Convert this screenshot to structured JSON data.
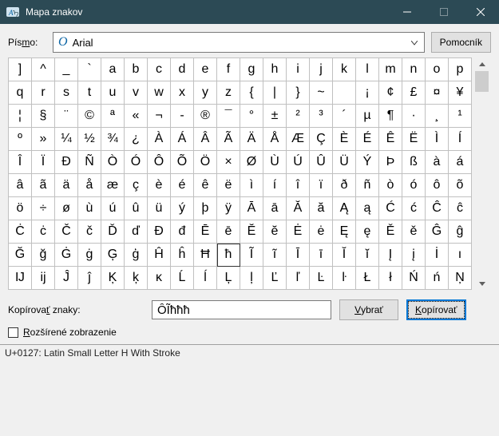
{
  "window": {
    "title": "Mapa znakov"
  },
  "toolbar": {
    "font_label_pre": "Pís",
    "font_label_u": "m",
    "font_label_post": "o:",
    "font_name": "Arial",
    "font_glyph": "O",
    "help_label": "Pomocník"
  },
  "grid": {
    "rows": [
      [
        "]",
        "^",
        "_",
        "`",
        "a",
        "b",
        "c",
        "d",
        "e",
        "f",
        "g",
        "h",
        "i",
        "j",
        "k",
        "l",
        "m",
        "n",
        "o",
        "p"
      ],
      [
        "q",
        "r",
        "s",
        "t",
        "u",
        "v",
        "w",
        "x",
        "y",
        "z",
        "{",
        "|",
        "}",
        "~",
        "",
        "¡",
        "¢",
        "£",
        "¤",
        "¥"
      ],
      [
        "¦",
        "§",
        "¨",
        "©",
        "ª",
        "«",
        "¬",
        "-",
        "®",
        "¯",
        "°",
        "±",
        "²",
        "³",
        "´",
        "µ",
        "¶",
        "·",
        "¸",
        "¹"
      ],
      [
        "º",
        "»",
        "¼",
        "½",
        "¾",
        "¿",
        "À",
        "Á",
        "Â",
        "Ã",
        "Ä",
        "Å",
        "Æ",
        "Ç",
        "È",
        "É",
        "Ê",
        "Ë",
        "Ì",
        "Í"
      ],
      [
        "Î",
        "Ï",
        "Ð",
        "Ñ",
        "Ò",
        "Ó",
        "Ô",
        "Õ",
        "Ö",
        "×",
        "Ø",
        "Ù",
        "Ú",
        "Û",
        "Ü",
        "Ý",
        "Þ",
        "ß",
        "à",
        "á"
      ],
      [
        "â",
        "ã",
        "ä",
        "å",
        "æ",
        "ç",
        "è",
        "é",
        "ê",
        "ë",
        "ì",
        "í",
        "î",
        "ï",
        "ð",
        "ñ",
        "ò",
        "ó",
        "ô",
        "õ"
      ],
      [
        "ö",
        "÷",
        "ø",
        "ù",
        "ú",
        "û",
        "ü",
        "ý",
        "þ",
        "ÿ",
        "Ā",
        "ā",
        "Ă",
        "ă",
        "Ą",
        "ą",
        "Ć",
        "ć",
        "Ĉ",
        "ĉ"
      ],
      [
        "Ċ",
        "ċ",
        "Č",
        "č",
        "Ď",
        "ď",
        "Đ",
        "đ",
        "Ē",
        "ē",
        "Ĕ",
        "ĕ",
        "Ė",
        "ė",
        "Ę",
        "ę",
        "Ě",
        "ě",
        "Ĝ",
        "ĝ"
      ],
      [
        "Ğ",
        "ğ",
        "Ġ",
        "ġ",
        "Ģ",
        "ģ",
        "Ĥ",
        "ĥ",
        "Ħ",
        "ħ",
        "Ĩ",
        "ĩ",
        "Ī",
        "ī",
        "Ĭ",
        "ĭ",
        "Į",
        "į",
        "İ",
        "ı"
      ],
      [
        "Ĳ",
        "ĳ",
        "Ĵ",
        "ĵ",
        "Ķ",
        "ķ",
        "ĸ",
        "Ĺ",
        "ĺ",
        "Ļ",
        "ļ",
        "Ľ",
        "ľ",
        "Ŀ",
        "ŀ",
        "Ł",
        "ł",
        "Ń",
        "ń",
        "Ņ"
      ]
    ],
    "selected": {
      "row": 8,
      "col": 9
    }
  },
  "copy": {
    "label_pre": "Kopírova",
    "label_u": "ť",
    "label_post": " znaky:",
    "value": "ÔĨħħħ",
    "select_label_u": "V",
    "select_label_post": "ybrať",
    "copy_label_u": "K",
    "copy_label_post": "opírovať"
  },
  "advanced": {
    "label_u": "R",
    "label_post": "ozšírené zobrazenie",
    "checked": false
  },
  "status": {
    "text": "U+0127: Latin Small Letter H With Stroke"
  }
}
